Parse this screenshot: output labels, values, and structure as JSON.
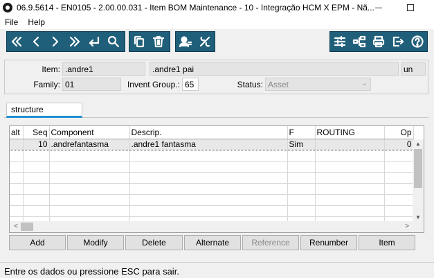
{
  "window": {
    "title": "06.9.5614 - EN0105 - 2.00.00.031 - Item BOM Maintenance - 10 - Integração HCM X EPM - Nã..."
  },
  "menu": {
    "file": "File",
    "help": "Help"
  },
  "toolbar": {
    "nav_icons": [
      "first-icon",
      "previous-icon",
      "next-icon",
      "last-icon",
      "enter-icon",
      "search-icon"
    ],
    "edit_icons": [
      "copy-icon",
      "delete-icon"
    ],
    "misc_icons": [
      "user-options-icon",
      "tools-icon"
    ],
    "right_icons": [
      "settings-sliders-icon",
      "structure-icon",
      "print-icon",
      "exit-icon",
      "help-icon"
    ],
    "accent_color": "#1f5f7a"
  },
  "header": {
    "item_label": "Item:",
    "item_value": ".andre1",
    "item_desc": ".andre1 pai",
    "unit": "un",
    "family_label": "Family:",
    "family_value": "01",
    "invent_group_label": "Invent Group.:",
    "invent_group_value": "65",
    "status_label": "Status:",
    "status_value": "Asset"
  },
  "tabs": {
    "structure": "structure"
  },
  "grid": {
    "columns": [
      "alt",
      "Seq",
      "Component",
      "Descrip.",
      "F",
      "ROUTING",
      "Op"
    ],
    "rows": [
      {
        "alt": "",
        "seq": "10",
        "component": ".andrefantasma",
        "descrip": ".andre1 fantasma",
        "f": "Sim",
        "routing": "",
        "op": "0"
      }
    ]
  },
  "buttons": {
    "add": "Add",
    "modify": "Modify",
    "delete": "Delete",
    "alternate": "Alternate",
    "reference": "Reference",
    "renumber": "Renumber",
    "item": "Item"
  },
  "status_bar": {
    "message": "Entre os dados ou pressione ESC para sair."
  }
}
